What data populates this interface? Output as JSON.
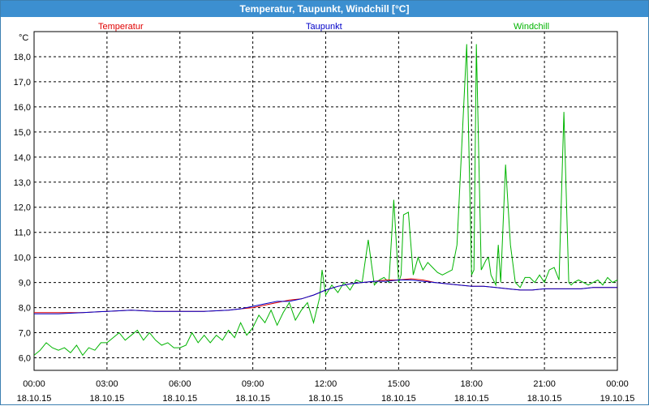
{
  "window": {
    "title": "Temperatur, Taupunkt, Windchill [°C]"
  },
  "chart_data": {
    "type": "line",
    "title": "Temperatur, Taupunkt, Windchill [°C]",
    "ylabel": "°C",
    "xlabel": "",
    "ylim": [
      5.5,
      19.0
    ],
    "xlim": [
      0,
      24
    ],
    "grid": true,
    "legend_placement": "top",
    "y_ticks": [
      "6,0",
      "7,0",
      "8,0",
      "9,0",
      "10,0",
      "11,0",
      "12,0",
      "13,0",
      "14,0",
      "15,0",
      "16,0",
      "17,0",
      "18,0"
    ],
    "x_ticks": [
      {
        "time": "00:00",
        "date": "18.10.15"
      },
      {
        "time": "03:00",
        "date": "18.10.15"
      },
      {
        "time": "06:00",
        "date": "18.10.15"
      },
      {
        "time": "09:00",
        "date": "18.10.15"
      },
      {
        "time": "12:00",
        "date": "18.10.15"
      },
      {
        "time": "15:00",
        "date": "18.10.15"
      },
      {
        "time": "18:00",
        "date": "18.10.15"
      },
      {
        "time": "21:00",
        "date": "18.10.15"
      },
      {
        "time": "00:00",
        "date": "19.10.15"
      }
    ],
    "series": [
      {
        "name": "Temperatur",
        "color": "#e00000",
        "x": [
          0,
          1,
          2,
          3,
          4,
          5,
          6,
          7,
          8,
          8.5,
          9,
          9.5,
          10,
          10.5,
          11,
          11.5,
          12,
          12.5,
          13,
          13.5,
          14,
          14.5,
          15,
          15.5,
          16,
          16.5,
          17,
          17.5,
          18,
          18.5,
          19,
          19.5,
          20,
          20.5,
          21,
          21.5,
          22,
          22.5,
          23,
          23.5,
          24
        ],
        "y": [
          7.8,
          7.8,
          7.8,
          7.85,
          7.9,
          7.85,
          7.85,
          7.85,
          7.9,
          7.95,
          8.0,
          8.1,
          8.2,
          8.3,
          8.35,
          8.5,
          8.7,
          8.85,
          8.95,
          9.0,
          9.05,
          9.1,
          9.1,
          9.15,
          9.1,
          9.0,
          8.95,
          8.9,
          8.85,
          8.85,
          8.8,
          8.75,
          8.7,
          8.7,
          8.75,
          8.75,
          8.75,
          8.75,
          8.8,
          8.8,
          8.8
        ]
      },
      {
        "name": "Taupunkt",
        "color": "#0000c8",
        "x": [
          0,
          1,
          2,
          3,
          4,
          5,
          6,
          7,
          8,
          8.5,
          9,
          9.5,
          10,
          10.5,
          11,
          11.5,
          12,
          12.5,
          13,
          13.5,
          14,
          14.5,
          15,
          15.5,
          16,
          16.5,
          17,
          17.5,
          18,
          18.5,
          19,
          19.5,
          20,
          20.5,
          21,
          21.5,
          22,
          22.5,
          23,
          23.5,
          24
        ],
        "y": [
          7.75,
          7.75,
          7.8,
          7.85,
          7.9,
          7.85,
          7.85,
          7.85,
          7.9,
          7.95,
          8.05,
          8.15,
          8.25,
          8.25,
          8.35,
          8.5,
          8.7,
          8.85,
          8.95,
          9.0,
          9.05,
          9.05,
          9.1,
          9.1,
          9.05,
          9.0,
          8.95,
          8.9,
          8.85,
          8.85,
          8.8,
          8.75,
          8.7,
          8.7,
          8.75,
          8.75,
          8.75,
          8.75,
          8.8,
          8.8,
          8.8
        ]
      },
      {
        "name": "Windchill",
        "color": "#00b400",
        "x": [
          0,
          0.25,
          0.5,
          0.75,
          1,
          1.25,
          1.5,
          1.75,
          2,
          2.25,
          2.5,
          2.75,
          3,
          3.25,
          3.5,
          3.75,
          4,
          4.25,
          4.5,
          4.75,
          5,
          5.25,
          5.5,
          5.75,
          6,
          6.25,
          6.5,
          6.75,
          7,
          7.25,
          7.5,
          7.75,
          8,
          8.25,
          8.5,
          8.75,
          9,
          9.25,
          9.5,
          9.75,
          10,
          10.25,
          10.5,
          10.75,
          11,
          11.25,
          11.5,
          11.75,
          11.85,
          12,
          12.25,
          12.5,
          12.75,
          13,
          13.25,
          13.5,
          13.75,
          14,
          14.2,
          14.4,
          14.6,
          14.8,
          15,
          15.1,
          15.2,
          15.4,
          15.6,
          15.8,
          16,
          16.2,
          16.4,
          16.6,
          16.8,
          17,
          17.2,
          17.4,
          17.6,
          17.8,
          18,
          18.1,
          18.2,
          18.4,
          18.6,
          18.7,
          18.8,
          18.9,
          19,
          19.1,
          19.2,
          19.4,
          19.6,
          19.8,
          20,
          20.2,
          20.4,
          20.6,
          20.8,
          21,
          21.2,
          21.4,
          21.6,
          21.8,
          22,
          22.1,
          22.2,
          22.4,
          22.6,
          22.8,
          23,
          23.2,
          23.4,
          23.6,
          23.8,
          24
        ],
        "y": [
          6.1,
          6.3,
          6.6,
          6.4,
          6.3,
          6.4,
          6.2,
          6.5,
          6.1,
          6.4,
          6.3,
          6.6,
          6.6,
          6.8,
          7.0,
          6.7,
          6.9,
          7.1,
          6.7,
          7.0,
          6.7,
          6.5,
          6.6,
          6.4,
          6.4,
          6.5,
          7.0,
          6.6,
          6.9,
          6.6,
          6.9,
          6.7,
          7.1,
          6.8,
          7.4,
          6.9,
          7.2,
          7.7,
          7.4,
          7.9,
          7.3,
          7.8,
          8.2,
          7.5,
          7.9,
          8.2,
          7.4,
          8.4,
          9.5,
          8.5,
          8.9,
          8.6,
          9.0,
          8.7,
          9.1,
          9.0,
          10.7,
          8.9,
          9.1,
          9.2,
          9.0,
          12.3,
          9.0,
          9.3,
          11.7,
          11.8,
          9.3,
          10.0,
          9.5,
          9.8,
          9.6,
          9.4,
          9.3,
          9.4,
          9.5,
          10.5,
          14.5,
          18.5,
          9.3,
          9.5,
          18.5,
          9.5,
          9.9,
          10.0,
          9.3,
          9.1,
          8.9,
          10.5,
          9.0,
          13.7,
          10.5,
          9.0,
          8.8,
          9.2,
          9.2,
          9.0,
          9.3,
          9.0,
          9.5,
          9.6,
          9.1,
          15.8,
          9.0,
          8.9,
          9.0,
          9.1,
          9.0,
          8.9,
          9.0,
          9.1,
          8.9,
          9.2,
          9.0,
          9.1
        ]
      }
    ]
  }
}
